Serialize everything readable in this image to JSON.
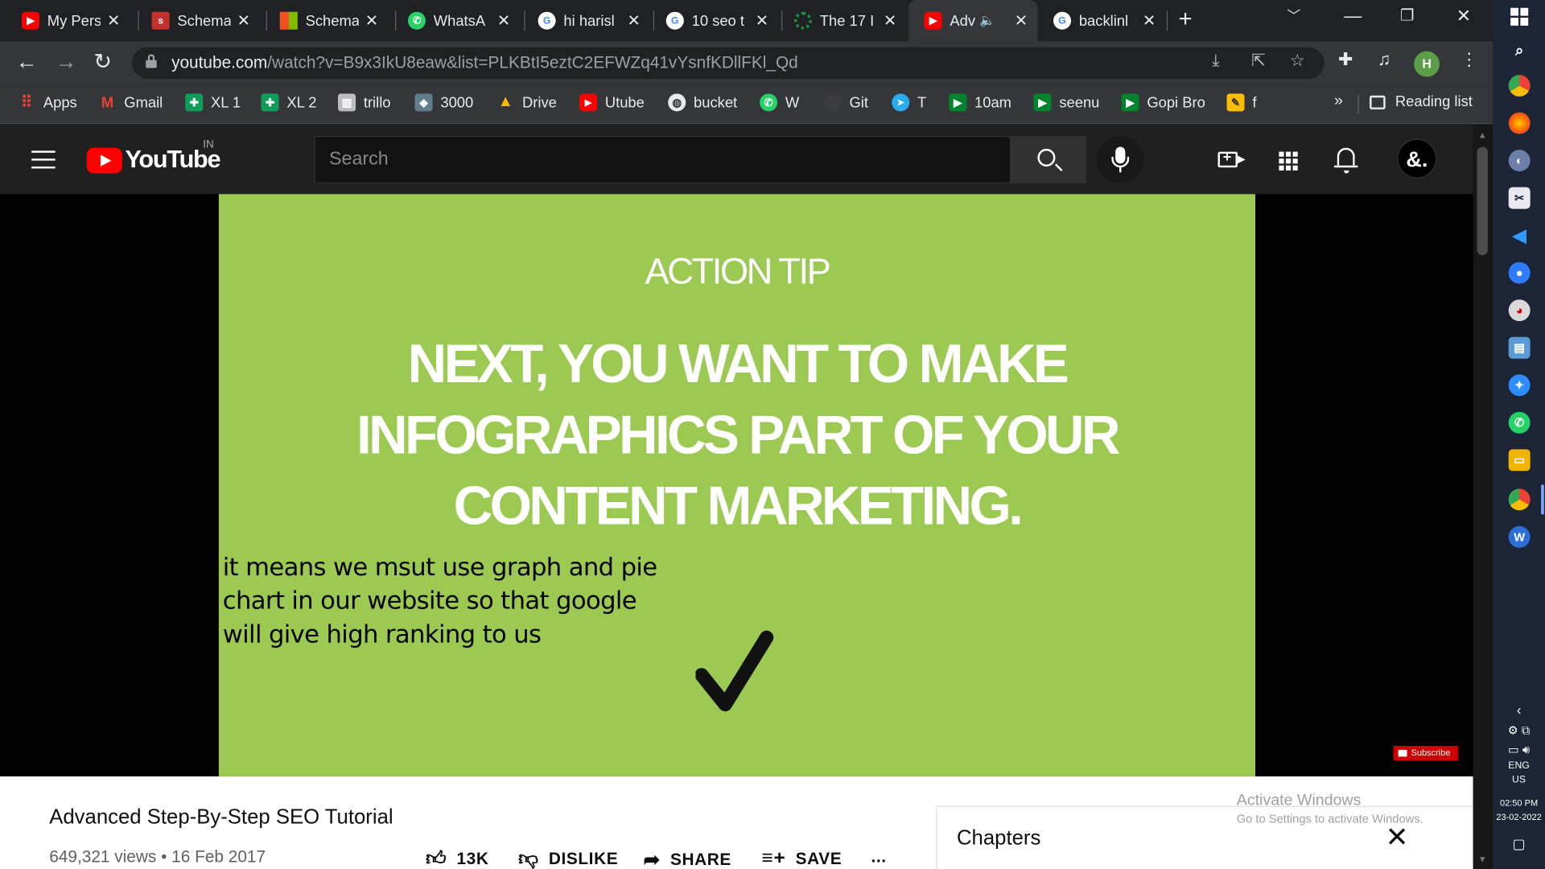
{
  "browser": {
    "tabs": [
      {
        "title": "My Pers",
        "icon": "youtube-icon",
        "color": "#ff0000"
      },
      {
        "title": "Schema",
        "icon": "schema-org-icon",
        "color": "#c4302b"
      },
      {
        "title": "Schema",
        "icon": "microsoft-icon",
        "color": "#f25022"
      },
      {
        "title": "WhatsA",
        "icon": "whatsapp-icon",
        "color": "#25d366"
      },
      {
        "title": "hi harisl",
        "icon": "google-icon",
        "color": "#4285f4"
      },
      {
        "title": "10 seo t",
        "icon": "google-icon",
        "color": "#4285f4"
      },
      {
        "title": "The 17 I",
        "icon": "loading-icon",
        "color": "#1e8e3e"
      },
      {
        "title": "Adv",
        "icon": "youtube-icon",
        "color": "#ff0000",
        "active": true,
        "audio": true
      },
      {
        "title": "backlinl",
        "icon": "google-icon",
        "color": "#4285f4"
      }
    ],
    "url_host": "youtube.com",
    "url_path": "/watch?v=B9x3IkU8eaw&list=PLKBtI5eztC2EFWZq41vYsnfKDllFKl_Qd",
    "profile_initial": "H",
    "bookmarks": [
      {
        "label": "Apps",
        "icon": "apps-grid-icon",
        "color": "#ea4335"
      },
      {
        "label": "Gmail",
        "icon": "gmail-icon",
        "color": "#ea4335"
      },
      {
        "label": "XL 1",
        "icon": "sheets-icon",
        "color": "#0f9d58"
      },
      {
        "label": "XL 2",
        "icon": "sheets-icon",
        "color": "#0f9d58"
      },
      {
        "label": "trillo",
        "icon": "trello-icon",
        "color": "#9e9e9e"
      },
      {
        "label": "3000",
        "icon": "site-icon",
        "color": "#607d8b"
      },
      {
        "label": "Drive",
        "icon": "drive-icon",
        "color": "#fbbc04"
      },
      {
        "label": "Utube",
        "icon": "youtube-icon",
        "color": "#ff0000"
      },
      {
        "label": "bucket",
        "icon": "globe-icon",
        "color": "#e8eaed"
      },
      {
        "label": "W",
        "icon": "whatsapp-icon",
        "color": "#25d366"
      },
      {
        "label": "Git",
        "icon": "github-icon",
        "color": "#3c3c3c"
      },
      {
        "label": "T",
        "icon": "telegram-icon",
        "color": "#2aabee"
      },
      {
        "label": "10am",
        "icon": "meet-icon",
        "color": "#00832d"
      },
      {
        "label": "seenu",
        "icon": "meet-icon",
        "color": "#00832d"
      },
      {
        "label": "Gopi Bro",
        "icon": "meet-icon",
        "color": "#00832d"
      },
      {
        "label": "f",
        "icon": "sticky-note-icon",
        "color": "#fbbc04"
      }
    ],
    "bookmarks_more": "»",
    "reading_list": "Reading list"
  },
  "youtube": {
    "logo_text": "YouTube",
    "country_code": "IN",
    "search_placeholder": "Search",
    "channel_avatar_text": "&."
  },
  "video": {
    "slide_label": "ACTION TIP",
    "slide_headline_lines": [
      "NEXT, YOU WANT TO MAKE",
      "INFOGRAPHICS PART OF YOUR",
      "CONTENT MARKETING."
    ],
    "overlay_note": "it means we msut use graph and pie chart in our website so that google will give high ranking to us",
    "slide_color": "#9bc952",
    "subscribe_watermark": "Subscribe",
    "title": "Advanced Step-By-Step SEO Tutorial",
    "views": "649,321 views",
    "date": "16 Feb 2017",
    "likes": "13K",
    "dislike_label": "DISLIKE",
    "share_label": "SHARE",
    "save_label": "SAVE",
    "more_label": "..."
  },
  "chapters_panel": {
    "title": "Chapters"
  },
  "windows_watermark": {
    "line1": "Activate Windows",
    "line2": "Go to Settings to activate Windows."
  },
  "taskbar": {
    "language": "ENG",
    "region": "US",
    "time": "02:50 PM",
    "date": "23-02-2022"
  }
}
